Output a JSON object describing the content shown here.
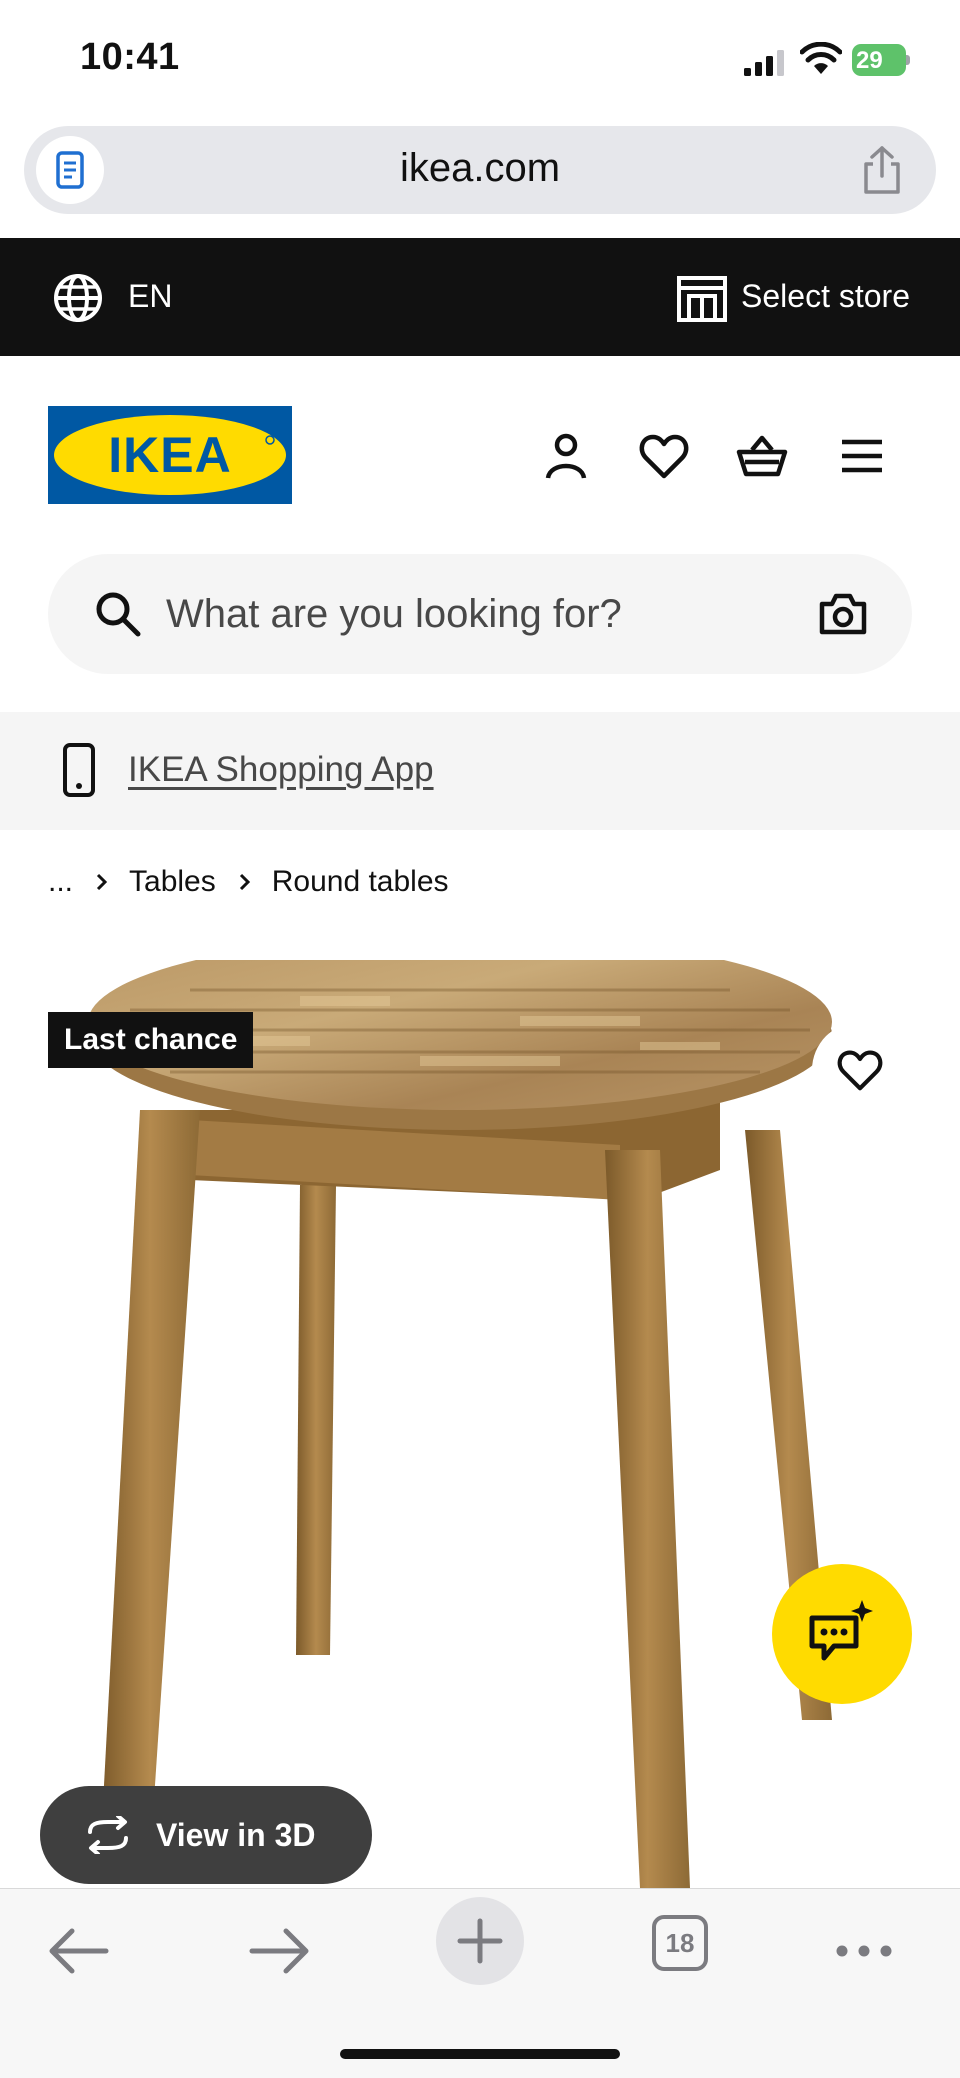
{
  "status_bar": {
    "time": "10:41",
    "battery": "29"
  },
  "browser": {
    "url": "ikea.com",
    "tab_count": "18"
  },
  "top_strip": {
    "language": "EN",
    "store_label": "Select store"
  },
  "header": {
    "logo_text": "IKEA"
  },
  "search": {
    "placeholder": "What are you looking for?"
  },
  "app_banner": {
    "label": "IKEA Shopping App"
  },
  "breadcrumb": {
    "ellipsis": "...",
    "items": [
      "Tables",
      "Round tables"
    ]
  },
  "product": {
    "badge": "Last chance",
    "view_3d_label": "View in 3D"
  },
  "colors": {
    "ikea_blue": "#0058a3",
    "ikea_yellow": "#ffdb00",
    "strip_black": "#111111",
    "battery_green": "#5ec26a"
  },
  "icons": [
    "page-icon",
    "share-icon",
    "globe-icon",
    "store-icon",
    "user-icon",
    "heart-icon",
    "basket-icon",
    "menu-icon",
    "search-icon",
    "camera-icon",
    "phone-icon",
    "chevron-right-icon",
    "chat-sparkle-icon",
    "rotate-3d-icon",
    "back-arrow-icon",
    "forward-arrow-icon",
    "plus-icon",
    "more-icon"
  ]
}
